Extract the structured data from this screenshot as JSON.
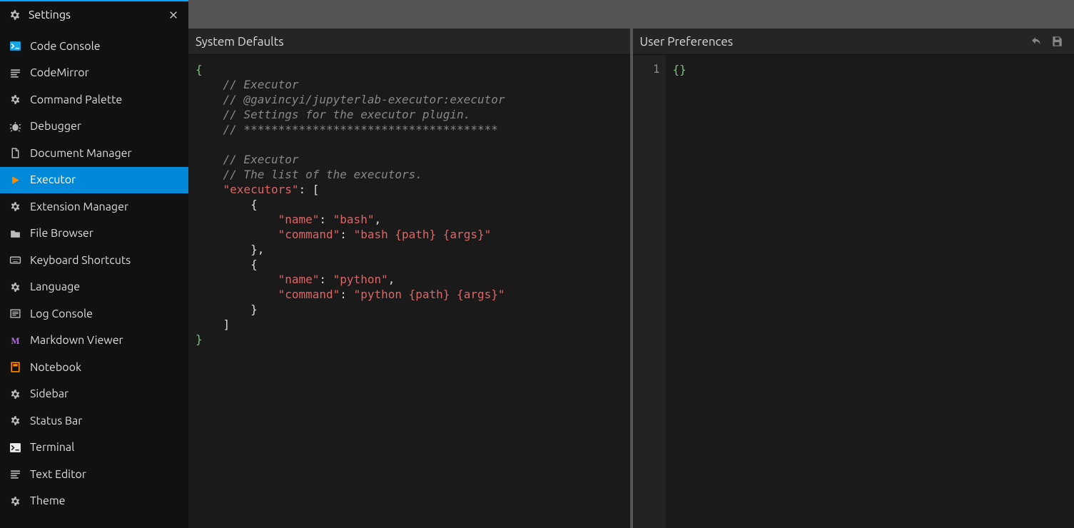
{
  "tab": {
    "title": "Settings"
  },
  "sidebar": {
    "items": [
      {
        "label": "Code Console",
        "icon": "terminal"
      },
      {
        "label": "CodeMirror",
        "icon": "lines"
      },
      {
        "label": "Command Palette",
        "icon": "gear"
      },
      {
        "label": "Debugger",
        "icon": "bug"
      },
      {
        "label": "Document Manager",
        "icon": "file"
      },
      {
        "label": "Executor",
        "icon": "play",
        "selected": true
      },
      {
        "label": "Extension Manager",
        "icon": "gear"
      },
      {
        "label": "File Browser",
        "icon": "folder"
      },
      {
        "label": "Keyboard Shortcuts",
        "icon": "keyboard"
      },
      {
        "label": "Language",
        "icon": "gear"
      },
      {
        "label": "Log Console",
        "icon": "list"
      },
      {
        "label": "Markdown Viewer",
        "icon": "markdown"
      },
      {
        "label": "Notebook",
        "icon": "notebook"
      },
      {
        "label": "Sidebar",
        "icon": "gear"
      },
      {
        "label": "Status Bar",
        "icon": "gear"
      },
      {
        "label": "Terminal",
        "icon": "terminal2"
      },
      {
        "label": "Text Editor",
        "icon": "lines"
      },
      {
        "label": "Theme",
        "icon": "gear"
      }
    ]
  },
  "panels": {
    "left": {
      "title": "System Defaults"
    },
    "right": {
      "title": "User Preferences",
      "gutter": "1"
    }
  },
  "code_left": {
    "lines": [
      {
        "t": "brace",
        "s": "{"
      },
      {
        "t": "comment",
        "s": "    // Executor"
      },
      {
        "t": "comment",
        "s": "    // @gavincyi/jupyterlab-executor:executor"
      },
      {
        "t": "comment",
        "s": "    // Settings for the executor plugin."
      },
      {
        "t": "comment",
        "s": "    // *************************************"
      },
      {
        "t": "blank",
        "s": ""
      },
      {
        "t": "comment",
        "s": "    // Executor"
      },
      {
        "t": "comment",
        "s": "    // The list of the executors."
      },
      {
        "t": "kv",
        "k": "    \"executors\"",
        "v": ": ["
      },
      {
        "t": "punct",
        "s": "        {"
      },
      {
        "t": "kv2",
        "k": "            \"name\"",
        "p": ": ",
        "v": "\"bash\"",
        "x": ","
      },
      {
        "t": "kv2",
        "k": "            \"command\"",
        "p": ": ",
        "v": "\"bash {path} {args}\"",
        "x": ""
      },
      {
        "t": "punct",
        "s": "        },"
      },
      {
        "t": "punct",
        "s": "        {"
      },
      {
        "t": "kv2",
        "k": "            \"name\"",
        "p": ": ",
        "v": "\"python\"",
        "x": ","
      },
      {
        "t": "kv2",
        "k": "            \"command\"",
        "p": ": ",
        "v": "\"python {path} {args}\"",
        "x": ""
      },
      {
        "t": "punct",
        "s": "        }"
      },
      {
        "t": "punct",
        "s": "    ]"
      },
      {
        "t": "brace",
        "s": "}"
      }
    ]
  },
  "code_right": "{}"
}
